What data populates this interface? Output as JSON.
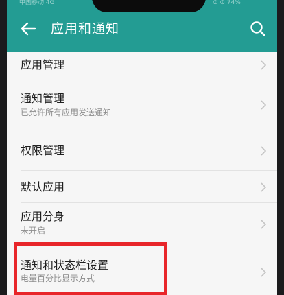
{
  "status_bar": {
    "left_text": "中国移动 4G",
    "right_text": "⊙ ⊙ 74%"
  },
  "header": {
    "title": "应用和通知",
    "back_icon": "arrow-left-icon",
    "search_icon": "search-icon",
    "background_color": "#239c93"
  },
  "settings_list": [
    {
      "label": "应用管理",
      "subtitle": ""
    },
    {
      "label": "通知管理",
      "subtitle": "已允许所有应用发送通知"
    },
    {
      "label": "权限管理",
      "subtitle": ""
    },
    {
      "label": "默认应用",
      "subtitle": ""
    },
    {
      "label": "应用分身",
      "subtitle": "未开启"
    },
    {
      "label": "通知和状态栏设置",
      "subtitle": "电量百分比显示方式"
    }
  ],
  "highlight": {
    "target": "通知和状态栏设置",
    "color": "#e8262a"
  }
}
